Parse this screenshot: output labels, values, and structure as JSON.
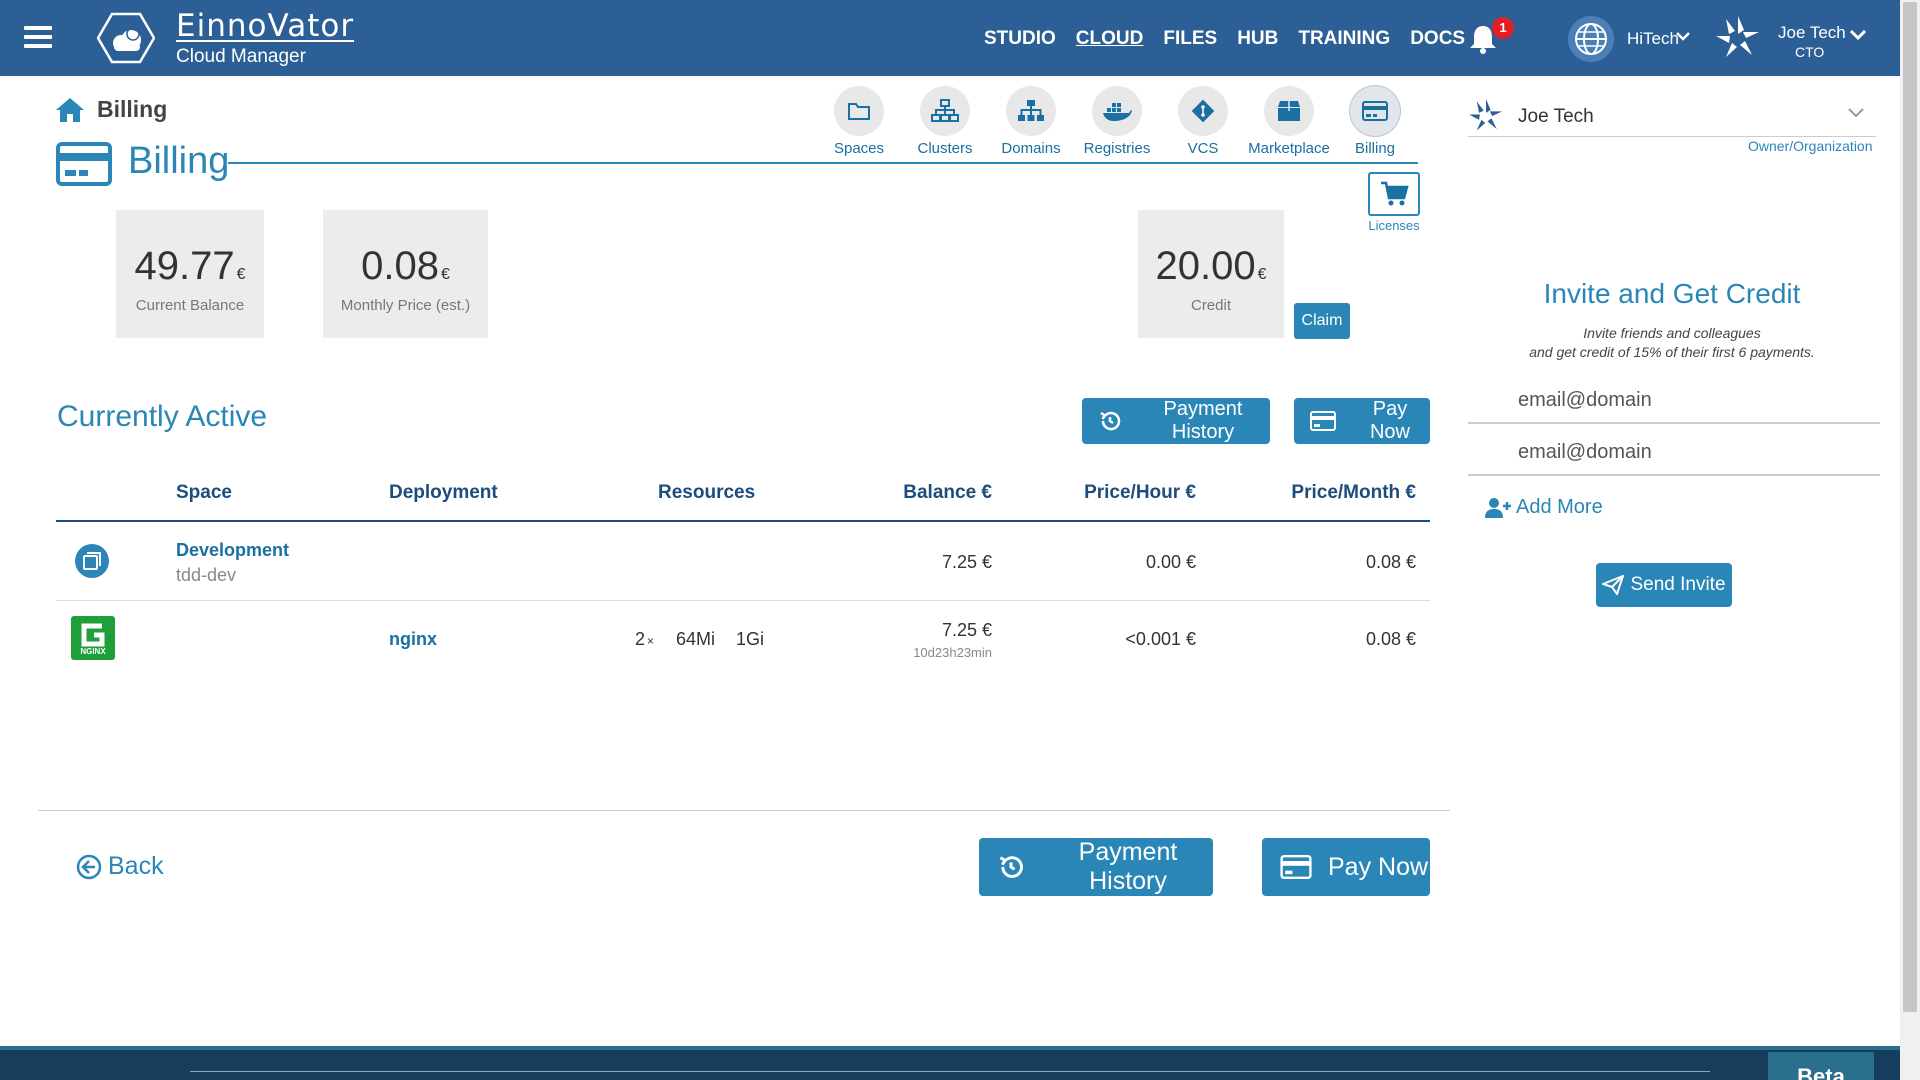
{
  "topbar": {
    "brand": "EinnoVator",
    "subtitle": "Cloud Manager",
    "nav": [
      "STUDIO",
      "CLOUD",
      "FILES",
      "HUB",
      "TRAINING",
      "DOCS"
    ],
    "active_nav": "CLOUD",
    "notification_count": "1",
    "org_name": "HiTech",
    "user_name": "Joe Tech",
    "user_role": "CTO"
  },
  "breadcrumb": {
    "label": "Billing"
  },
  "page_title": "Billing",
  "section_nav": [
    {
      "label": "Spaces",
      "icon": "folder-icon"
    },
    {
      "label": "Clusters",
      "icon": "clusters-icon"
    },
    {
      "label": "Domains",
      "icon": "domains-icon"
    },
    {
      "label": "Registries",
      "icon": "docker-icon"
    },
    {
      "label": "VCS",
      "icon": "git-icon"
    },
    {
      "label": "Marketplace",
      "icon": "box-icon"
    },
    {
      "label": "Billing",
      "icon": "credit-card-icon"
    }
  ],
  "licenses_label": "Licenses",
  "cards": {
    "balance": {
      "value": "49.77",
      "currency": "€",
      "caption": "Current Balance"
    },
    "monthly": {
      "value": "0.08",
      "currency": "€",
      "caption": "Monthly Price (est.)"
    },
    "credit": {
      "value": "20.00",
      "currency": "€",
      "caption": "Credit"
    }
  },
  "claim_label": "Claim",
  "active": {
    "heading": "Currently Active",
    "payment_history_label": "Payment History",
    "pay_now_label": "Pay Now",
    "columns": [
      "Space",
      "Deployment",
      "Resources",
      "Balance €",
      "Price/Hour €",
      "Price/Month €"
    ],
    "space_row": {
      "name": "Development",
      "id": "tdd-dev",
      "balance": "7.25 €",
      "price_hour": "0.00 €",
      "price_month": "0.08 €"
    },
    "deployment_row": {
      "icon_text": "NGINX",
      "name": "nginx",
      "replicas": "2",
      "replicas_suffix": "×",
      "memory": "64Mi",
      "storage": "1Gi",
      "balance": "7.25 €",
      "duration": "10d23h23min",
      "price_hour": "<0.001 €",
      "price_month": "0.08 €"
    }
  },
  "bottom": {
    "back_label": "Back",
    "payment_history_label": "Payment History",
    "pay_now_label": "Pay Now"
  },
  "right_panel": {
    "owner_name": "Joe Tech",
    "owner_role": "Owner/Organization",
    "invite_title": "Invite and Get Credit",
    "invite_sub_1": "Invite friends and colleagues",
    "invite_sub_2": "and get credit of 15% of their first 6 payments.",
    "email_placeholder": "email@domain",
    "add_more_label": "Add More",
    "send_label": "Send Invite"
  },
  "footer": {
    "badge": "Beta"
  },
  "colors": {
    "brand": "#2c5f96",
    "accent": "#2a86b7",
    "nginx": "#1f9f3a",
    "badge": "#e41e26"
  }
}
